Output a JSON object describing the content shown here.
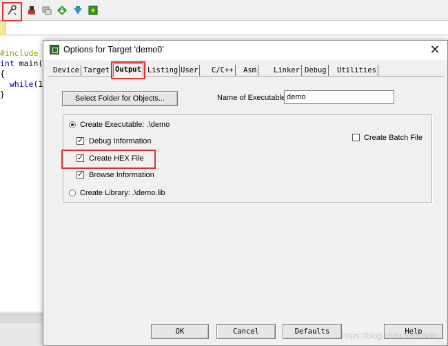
{
  "ide": {
    "toolbar_icons": [
      "options-for-target-icon",
      "load-icon",
      "rebuild-icon",
      "download-icon",
      "debug-icon",
      "pack-icon"
    ],
    "code_lines": [
      {
        "pp": "#include",
        "rest": ""
      },
      {
        "kw": "int",
        "rest": " main("
      },
      {
        "rest": "{"
      },
      {
        "indent": "  ",
        "kw": "while",
        "rest": "(1"
      },
      {
        "rest": "}"
      }
    ]
  },
  "dialog": {
    "title": "Options for Target 'demo0'",
    "close_glyph": "✕",
    "tabs": [
      "Device",
      "Target",
      "Output",
      "Listing",
      "User",
      "C/C++",
      "Asm",
      "Linker",
      "Debug",
      "Utilities"
    ],
    "active_tab": "Output",
    "select_folder_label": "Select Folder for Objects...",
    "name_of_executable_label": "Name of Executable:",
    "name_of_executable_value": "demo",
    "create_executable_label": "Create Executable:  .\\demo",
    "debug_info_label": "Debug Information",
    "create_hex_label": "Create HEX File",
    "browse_info_label": "Browse Information",
    "create_library_label": "Create Library:  .\\demo.lib",
    "create_batch_label": "Create Batch File",
    "checks": {
      "debug_info": true,
      "create_hex": true,
      "browse_info": true,
      "create_batch": false
    },
    "radio_selected": "create_executable",
    "buttons": {
      "ok": "OK",
      "cancel": "Cancel",
      "defaults": "Defaults",
      "help": "Help"
    }
  },
  "colors": {
    "highlight_red": "#e03030",
    "preprocessor": "#a0a000",
    "keyword": "#0000c0"
  },
  "watermark": "https://blog.csdn.net/xdolo"
}
